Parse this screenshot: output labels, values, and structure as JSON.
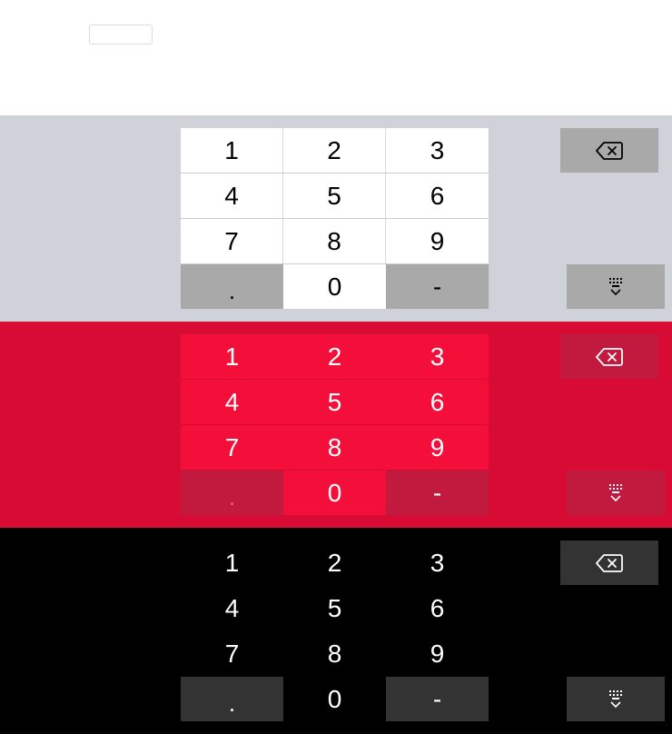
{
  "input": {
    "value": ""
  },
  "keyboards": [
    {
      "theme": "light",
      "background": "#cfd3d9",
      "keys": {
        "k1": "1",
        "k2": "2",
        "k3": "3",
        "k4": "4",
        "k5": "5",
        "k6": "6",
        "k7": "7",
        "k8": "8",
        "k9": "9",
        "dot": ".",
        "k0": "0",
        "dash": "-"
      },
      "icons": {
        "backspace": "backspace-icon",
        "dismiss": "keyboard-dismiss-icon"
      }
    },
    {
      "theme": "red",
      "background": "#d80b34",
      "keys": {
        "k1": "1",
        "k2": "2",
        "k3": "3",
        "k4": "4",
        "k5": "5",
        "k6": "6",
        "k7": "7",
        "k8": "8",
        "k9": "9",
        "dot": ".",
        "k0": "0",
        "dash": "-"
      },
      "icons": {
        "backspace": "backspace-icon",
        "dismiss": "keyboard-dismiss-icon"
      }
    },
    {
      "theme": "dark",
      "background": "#000000",
      "keys": {
        "k1": "1",
        "k2": "2",
        "k3": "3",
        "k4": "4",
        "k5": "5",
        "k6": "6",
        "k7": "7",
        "k8": "8",
        "k9": "9",
        "dot": ".",
        "k0": "0",
        "dash": "-"
      },
      "icons": {
        "backspace": "backspace-icon",
        "dismiss": "keyboard-dismiss-icon"
      }
    }
  ]
}
